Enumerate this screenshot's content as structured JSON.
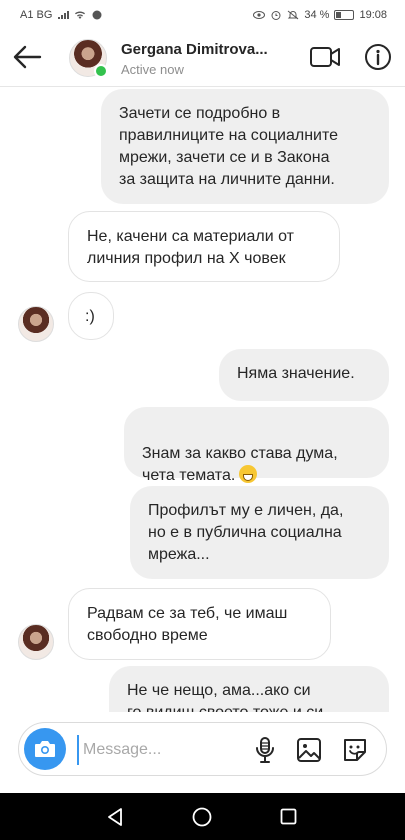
{
  "status_bar": {
    "carrier": "A1 BG",
    "battery": "34 %",
    "battery_level": 0.34,
    "time": "19:08"
  },
  "header": {
    "contact_name": "Gergana Dimitrova...",
    "presence": "Active now"
  },
  "messages": [
    {
      "direction": "outgoing",
      "text": "Зачети се подробно в\nправилниците на социалните\nмрежи, зачети се и в Закона\nза защита на личните данни."
    },
    {
      "direction": "incoming",
      "text": "Не, качени са материали от\nличния профил на Х човек"
    },
    {
      "direction": "incoming",
      "text": ":)"
    },
    {
      "direction": "outgoing",
      "text": "Няма значение."
    },
    {
      "direction": "outgoing",
      "text": "Знам за какво става дума,\nчета темата."
    },
    {
      "direction": "outgoing",
      "text": "Профилът му е личен, да,\nно е в публична социална\nмрежа..."
    },
    {
      "direction": "incoming",
      "text": "Радвам се за теб, че имаш\nсвободно време"
    },
    {
      "direction": "outgoing",
      "text": "Не че нещо, ама...ако си\nго видиш своето тоже и си"
    }
  ],
  "composer": {
    "placeholder": "Message..."
  },
  "colors": {
    "accent": "#3797f0",
    "online": "#33c24d",
    "outgoing_bubble": "#efefef"
  },
  "icons": {
    "back": "arrow-left-icon",
    "video": "video-camera-icon",
    "info": "info-icon",
    "camera": "camera-icon",
    "mic": "microphone-icon",
    "gallery": "image-icon",
    "sticker": "sticker-icon",
    "emoji": "grinning-face-icon"
  }
}
